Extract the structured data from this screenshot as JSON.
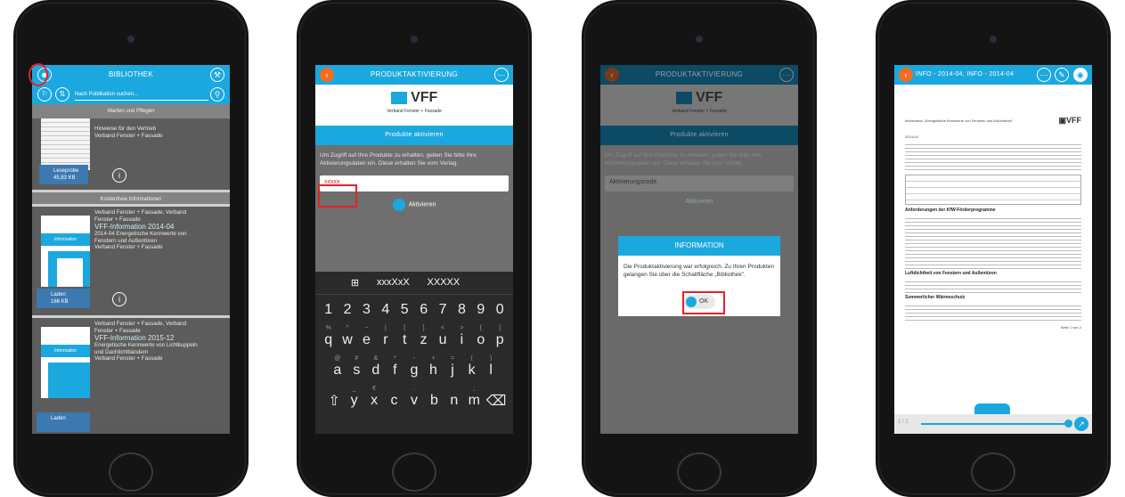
{
  "s1": {
    "title": "BIBLIOTHEK",
    "search_placeholder": "Nach Publikation suchen...",
    "sec1": "Warten und Pflegen",
    "item1": {
      "l1": "Hinweise für den Vertrieb",
      "l2": "Verband Fenster + Fassade",
      "dl": "Leseprobe",
      "size": "45,83 KB"
    },
    "sec2": "Kostenfreie Informationen",
    "item2": {
      "l1": "Verband Fenster + Fassade, Verband",
      "l2": "Fenster + Fassade",
      "big": "VFF-Information 2014-04",
      "l3": "2014-04 Energetische Kennwerte von",
      "l4": "Fenstern und Außentüren",
      "l5": "Verband Fenster + Fassade",
      "dl": "Laden",
      "size": "166 KB",
      "cover": "Information"
    },
    "item3": {
      "l1": "Verband Fenster + Fassade, Verband",
      "l2": "Fenster + Fassade",
      "big": "VFF-Information 2015-12",
      "l3": "Energetische Kennwerte von Lichtkuppeln",
      "l4": "und Dachlichtbändern",
      "l5": "Verband Fenster + Fassade",
      "dl": "Laden",
      "cover": "Information"
    }
  },
  "s2": {
    "title": "PRODUKTAKTIVIERUNG",
    "logo": "VFF",
    "logo_sub": "Verband Fenster + Fassade",
    "bar2": "Produkte aktivieren",
    "text": "Um Zugriff auf Ihre Produkte zu erhalten, geben Sie bitte Ihre Aktivierungsdaten ein. Diese erhalten Sie vom Verlag.",
    "input": "xxxxx",
    "btn": "Aktivieren",
    "sug": [
      "xxxXxX",
      "XXXXX"
    ],
    "row0": [
      "1",
      "2",
      "3",
      "4",
      "5",
      "6",
      "7",
      "8",
      "9",
      "0"
    ],
    "row1": [
      "q",
      "w",
      "e",
      "r",
      "t",
      "z",
      "u",
      "i",
      "o",
      "p"
    ],
    "row1sup": [
      "%",
      "^",
      "~",
      "|",
      "[",
      "]",
      "<",
      ">",
      "{",
      "}"
    ],
    "row2": [
      "a",
      "s",
      "d",
      "f",
      "g",
      "h",
      "j",
      "k",
      "l"
    ],
    "row2sup": [
      "@",
      "#",
      "&",
      "*",
      "-",
      "+",
      "=",
      "(",
      ")"
    ],
    "row3": [
      "y",
      "x",
      "c",
      "v",
      "b",
      "n",
      "m"
    ],
    "row3sup": [
      "_",
      "€",
      "",
      ".",
      "",
      "",
      ";"
    ]
  },
  "s3": {
    "title": "PRODUKTAKTIVIERUNG",
    "logo": "VFF",
    "logo_sub": "Verband Fenster + Fassade",
    "bar2": "Produkte aktivieren",
    "text": "Um Zugriff auf Ihre Produkte zu erhalten, geben Sie bitte Ihre Aktivierungsdaten ein. Diese erhalten Sie vom Verlag.",
    "input": "Aktivierungscode",
    "btn": "Aktivieren",
    "dialog_title": "INFORMATION",
    "dialog_text": "Die Produktaktivierung war erfolgreich. Zu Ihren Produkten gelangen Sie über die Schaltfläche „Bibliothek\".",
    "ok": "OK"
  },
  "s4": {
    "title": "INFO - 2014-04, INFO - 2014-04",
    "doc_head": "Information „Energetische Kennwerte von Fenstern und Außentüren\"",
    "doc_date": "2014-04",
    "h1": "Anforderungen der KfW-Förderprogramme",
    "h2": "Luftdichtheit von Fenstern und Außentüren",
    "h3": "Sommerlicher Wärmeschutz",
    "page": "Seite 1 von 2",
    "pages": "1 / 2"
  }
}
